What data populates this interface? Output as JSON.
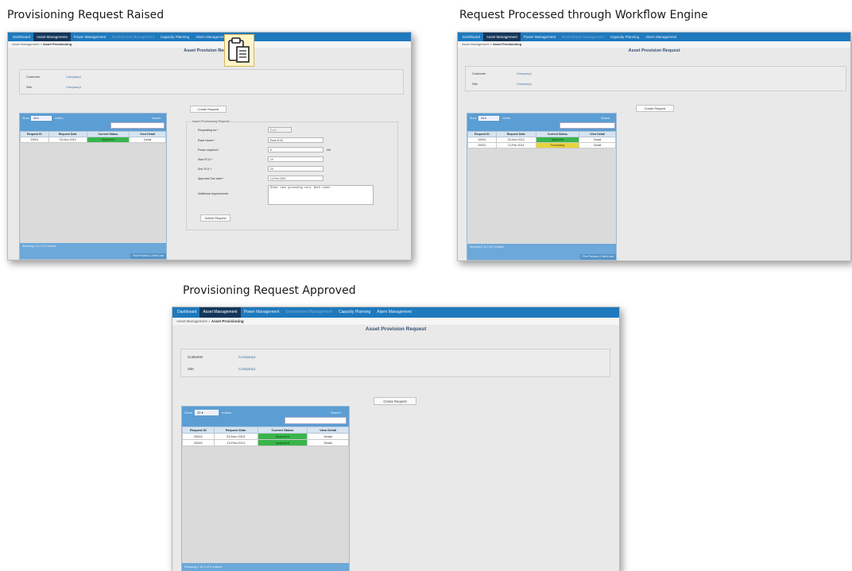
{
  "captions": {
    "raised": "Provisioning Request Raised",
    "processed": "Request Processed through Workflow Engine",
    "approved": "Provisioning Request Approved"
  },
  "app": {
    "nav": [
      "Dashboard",
      "Asset Management",
      "Power Management",
      "Environment Management",
      "Capacity Planning",
      "Alarm Management"
    ],
    "breadcrumb": [
      "Asset Management",
      "»",
      "Asset Provisioning"
    ],
    "title": "Asset Provision Request",
    "customer_label": "Customer",
    "customer_value": "Company1",
    "site_label": "Site",
    "site_value": "Company1",
    "create_button": "Create Request",
    "grid": {
      "show_label": "Show",
      "show_value": "25",
      "entries_label": "entries",
      "search_label": "Search:",
      "columns": [
        "Request ID",
        "Request Date",
        "Current Status",
        "View Detail"
      ],
      "detail_label": "Detail",
      "footer": "Showing 1 to 2 of 2 entries",
      "pager": [
        "First",
        "Previous",
        "1",
        "Next",
        "Last"
      ]
    },
    "form": {
      "legend": "Asset Provisioning Request",
      "fields": [
        {
          "label": "Requesting for:*",
          "value": "Rack",
          "disabled": true
        },
        {
          "label": "Rack Name:*",
          "value": "Rack B-06"
        },
        {
          "label": "Power required:*",
          "value": "5",
          "unit": "kW"
        },
        {
          "label": "Start 'R.U':*",
          "value": "10"
        },
        {
          "label": "End 'R.U':*",
          "value": "20"
        },
        {
          "label": "Approval Due date:*",
          "value": "14-Feb-2014"
        },
        {
          "label": "Additional requirements:",
          "value": "Other rack grounding cord. Both sides"
        }
      ],
      "submit": "Submit Request"
    }
  },
  "panels": {
    "raised": {
      "rows": [
        {
          "id": "20001",
          "date": "03-Nov-2013",
          "status": "Approved",
          "status_color": "#39b54a"
        }
      ]
    },
    "processed": {
      "rows": [
        {
          "id": "20001",
          "date": "03-Nov-2013",
          "status": "Approved",
          "status_color": "#39b54a"
        },
        {
          "id": "20001",
          "date": "13-Feb-2014",
          "status": "Processing",
          "status_color": "#e7d43c"
        }
      ]
    },
    "approved": {
      "rows": [
        {
          "id": "20001",
          "date": "03-Nov-2013",
          "status": "Approved",
          "status_color": "#39b54a"
        },
        {
          "id": "20001",
          "date": "13-Feb-2014",
          "status": "Approved",
          "status_color": "#39b54a"
        }
      ]
    }
  },
  "colors": {
    "nav": "#1e79bd",
    "nav_active": "#14365a",
    "approved": "#39b54a",
    "processing": "#e7d43c",
    "grid_header": "#5b9ed3"
  },
  "icons": {
    "clipboard": "clipboard-paste-icon"
  }
}
